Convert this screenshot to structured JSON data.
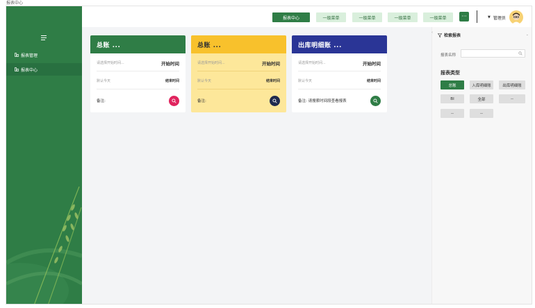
{
  "window": {
    "title": "报表中心"
  },
  "sidebar": {
    "items": [
      {
        "label": "报表管理",
        "active": false
      },
      {
        "label": "报表中心",
        "active": true
      }
    ]
  },
  "topbar": {
    "buttons": [
      {
        "label": "报表中心",
        "active": true
      },
      {
        "label": "一级菜单",
        "active": false
      },
      {
        "label": "一级菜单",
        "active": false
      },
      {
        "label": "一级菜单",
        "active": false
      },
      {
        "label": "一级菜单",
        "active": false
      }
    ],
    "more_label": "···",
    "user_name": "管理员"
  },
  "cards": [
    {
      "title": "总账 ...",
      "start_placeholder": "请选择开始时间...",
      "start_label": "开始时间",
      "end_placeholder": "默认今天",
      "end_label": "结束时间",
      "note_label": "备注:",
      "note_text": "",
      "theme": {
        "head_bg": "#2f7d46",
        "head_fg": "#ffffff",
        "body_bg": "#ffffff",
        "fab": "#e0245e"
      }
    },
    {
      "title": "总账 ...",
      "start_placeholder": "请选择开始时间...",
      "start_label": "开始时间",
      "end_placeholder": "默认今天",
      "end_label": "结束时间",
      "note_label": "备注:",
      "note_text": "",
      "theme": {
        "head_bg": "#f8c12c",
        "head_fg": "#333333",
        "body_bg": "#fde79a",
        "fab": "#1f2a4e"
      }
    },
    {
      "title": "出库明细账 ...",
      "start_placeholder": "请选择开始时间...",
      "start_label": "开始时间",
      "end_placeholder": "默认今天",
      "end_label": "结束时间",
      "note_label": "备注:",
      "note_text": "请搜索时间段查看报表",
      "theme": {
        "head_bg": "#2a3596",
        "head_fg": "#ffffff",
        "body_bg": "#ffffff",
        "fab": "#2f7d46"
      }
    }
  ],
  "panel": {
    "title": "检索报表",
    "name_label": "报表名称",
    "name_placeholder": "",
    "type_title": "报表类型",
    "types": [
      {
        "label": "总账",
        "selected": true
      },
      {
        "label": "入库明细账",
        "selected": false
      },
      {
        "label": "出库明细账",
        "selected": false
      },
      {
        "label": "BI",
        "selected": false
      },
      {
        "label": "全部",
        "selected": false
      },
      {
        "label": "--",
        "selected": false
      },
      {
        "label": "--",
        "selected": false
      },
      {
        "label": "--",
        "selected": false
      }
    ]
  },
  "colors": {
    "primary": "#2f7d46",
    "primary_light": "#d9efdc"
  },
  "icons": {
    "sidebar": [
      "collapse-icon",
      "report-manage-icon",
      "report-center-icon"
    ],
    "cards": [
      "search-icon"
    ],
    "panel": [
      "filter-icon",
      "search-icon"
    ],
    "user": [
      "caret-down-icon",
      "avatar"
    ]
  }
}
